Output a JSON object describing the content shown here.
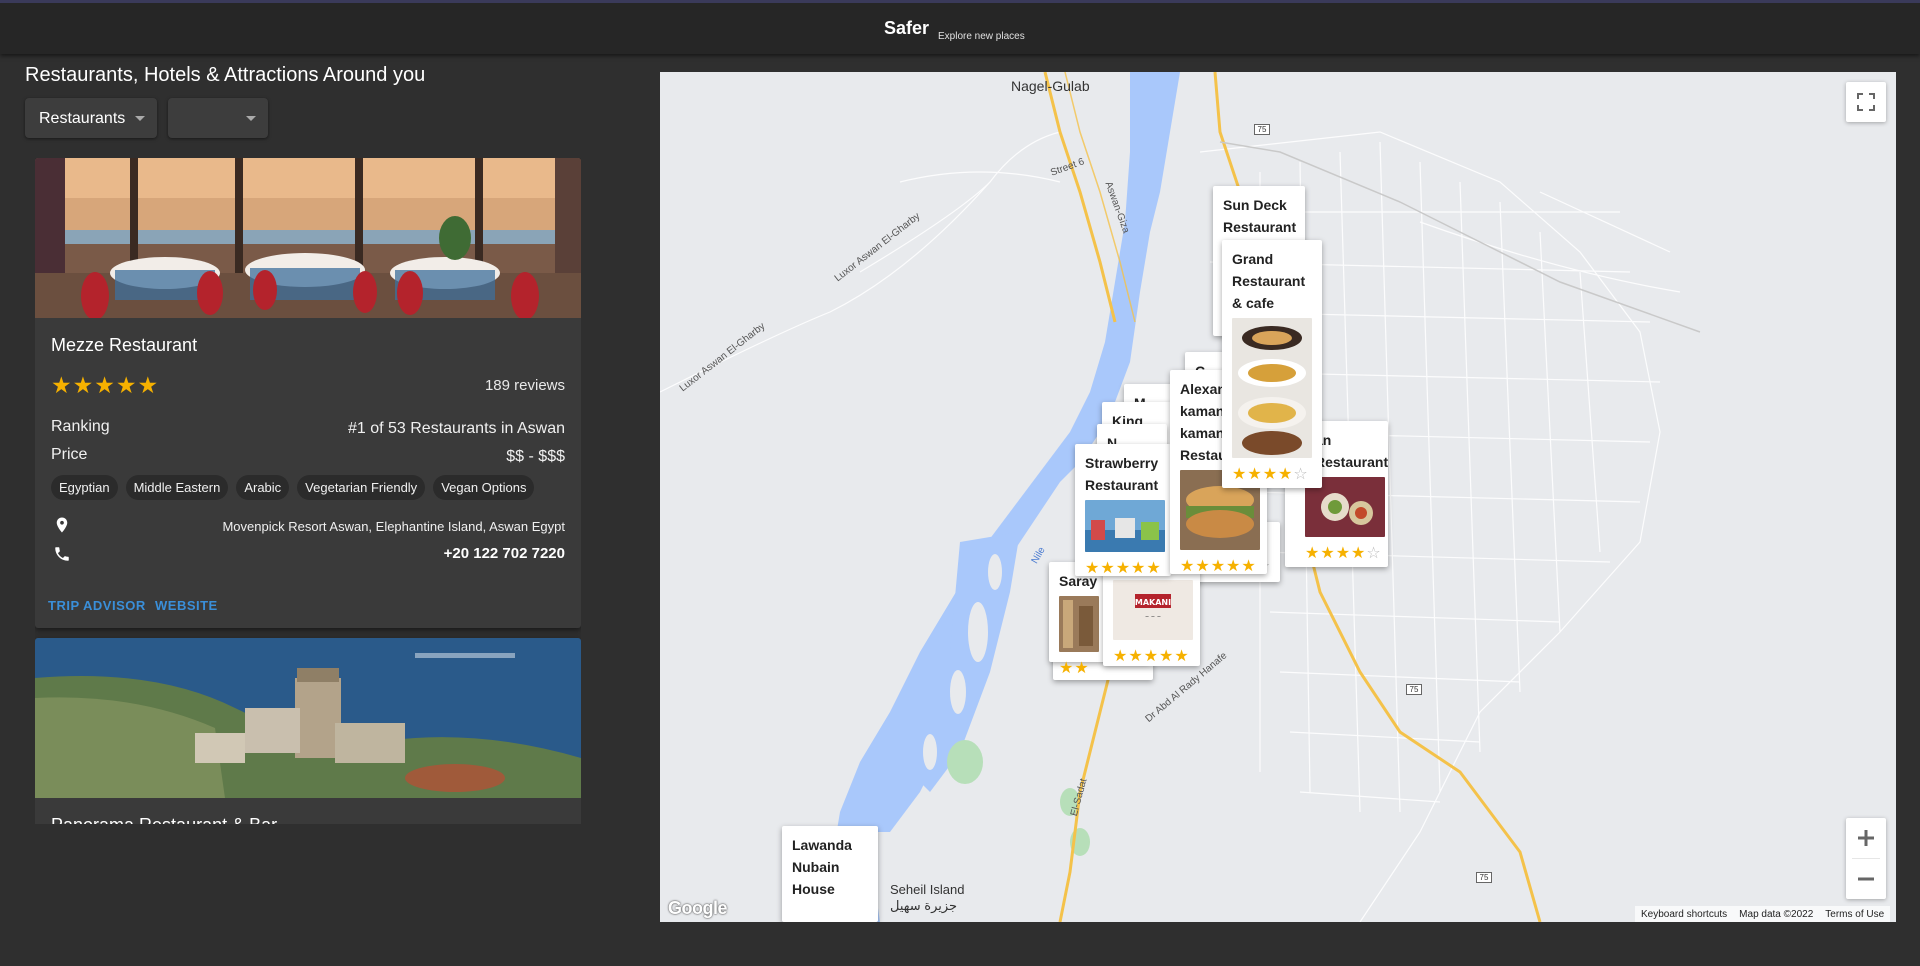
{
  "header": {
    "brand": "Safer",
    "tagline": "Explore new places"
  },
  "page": {
    "heading": "Restaurants, Hotels & Attractions Around you",
    "type_select": "Restaurants",
    "rating_select": ""
  },
  "cards": [
    {
      "name": "Mezze Restaurant",
      "rating": 5,
      "stars": "★★★★★",
      "reviews": "189 reviews",
      "ranking_label": "Ranking",
      "ranking_value": "#1 of 53 Restaurants in Aswan",
      "price_label": "Price",
      "price_value": "$$ - $$$",
      "cuisines": [
        "Egyptian",
        "Middle Eastern",
        "Arabic",
        "Vegetarian Friendly",
        "Vegan Options"
      ],
      "address": "Movenpick Resort Aswan, Elephantine Island, Aswan Egypt",
      "phone": "+20 122 702 7220",
      "link_tripadvisor": "TRIP ADVISOR",
      "link_website": "WEBSITE"
    },
    {
      "name": "Panorama Restaurant & Bar"
    }
  ],
  "map": {
    "labels": {
      "nagel": "Nagel-Gulab",
      "seheil_en": "Seheil Island",
      "seheil_ar": "جزيرة سهيل",
      "nile": "Nile",
      "street6": "Street 6",
      "aswan_giza": "Aswan-Giza",
      "luxor1": "Luxor Aswan El-Gharby",
      "luxor2": "Luxor Aswan El-Gharby",
      "elsadat": "El-Sadat",
      "abdalrady": "Dr Abd Al Rady Hanafe",
      "route75": "75"
    },
    "popups": {
      "sun_deck": "Sun Deck Restaurant",
      "grand": "Grand Restaurant & cafe",
      "alexandria": "Alexandria kaman kaman Restaurant",
      "king": "King",
      "m_partial": "M",
      "n_partial": "N",
      "c_partial": "C",
      "strawberry": "Strawberry Restaurant",
      "an_restaurant": "an Restaurant",
      "saray": "Saray",
      "makani_logo": "MAKANI",
      "lawanda": "Lawanda Nubain House"
    },
    "stars": {
      "grand": "★★★★",
      "grand_empty": "☆",
      "strawberry": "★★★★★",
      "alexandria": "★★★★★",
      "an_restaurant": "★★★★",
      "an_restaurant_empty": "☆",
      "hidden_row": "★★★",
      "hidden_row_empty": "☆",
      "makani": "★★★★★",
      "saray": "★★",
      "saray_row2": "★★★★★"
    },
    "footer": {
      "shortcuts": "Keyboard shortcuts",
      "mapdata": "Map data ©2022",
      "terms": "Terms of Use"
    },
    "logo": "Google"
  },
  "colors": {
    "accent_link": "#3a8fd9",
    "star": "#f6b100",
    "water": "#a9c8fb",
    "highway": "#f4c24a"
  }
}
